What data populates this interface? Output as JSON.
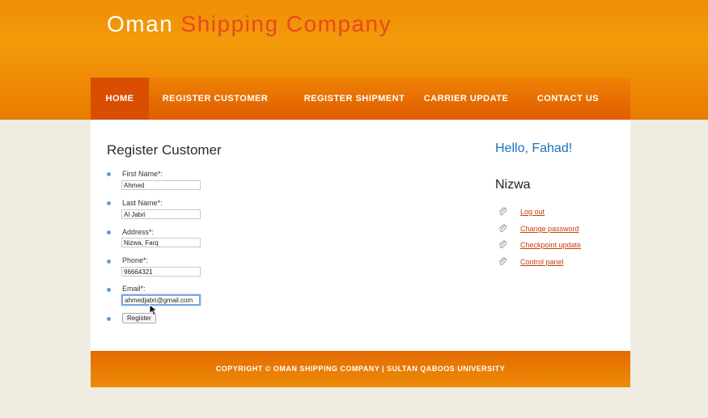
{
  "site": {
    "title_part1": "Oman",
    "title_part2": "Shipping Company"
  },
  "nav": {
    "items": [
      {
        "label": "HOME",
        "active": true
      },
      {
        "label": "REGISTER CUSTOMER",
        "active": false
      },
      {
        "label": "REGISTER SHIPMENT",
        "active": false
      },
      {
        "label": "CARRIER UPDATE",
        "active": false
      },
      {
        "label": "CONTACT US",
        "active": false
      }
    ]
  },
  "form": {
    "heading": "Register Customer",
    "fields": [
      {
        "label": "First Name*:",
        "value": "Ahmed"
      },
      {
        "label": "Last Name*:",
        "value": "Al Jabri"
      },
      {
        "label": "Address*:",
        "value": "Nizwa, Farq"
      },
      {
        "label": "Phone*:",
        "value": "96664321"
      },
      {
        "label": "Email*:",
        "value": "ahmedjabri@gmail.com"
      }
    ],
    "submit_label": "Register"
  },
  "sidebar": {
    "greeting": "Hello, Fahad!",
    "location": "Nizwa",
    "links": [
      "Log out",
      "Change password",
      "Checkpoint update",
      "Control panel"
    ]
  },
  "footer": {
    "text": "COPYRIGHT © OMAN SHIPPING COMPANY | SULTAN QABOOS UNIVERSITY"
  },
  "colors": {
    "header_orange": "#ef8e05",
    "title_accent": "#e8491f",
    "greeting_blue": "#1b72c0",
    "link_orange": "#c4420c",
    "page_bg": "#efece2"
  }
}
